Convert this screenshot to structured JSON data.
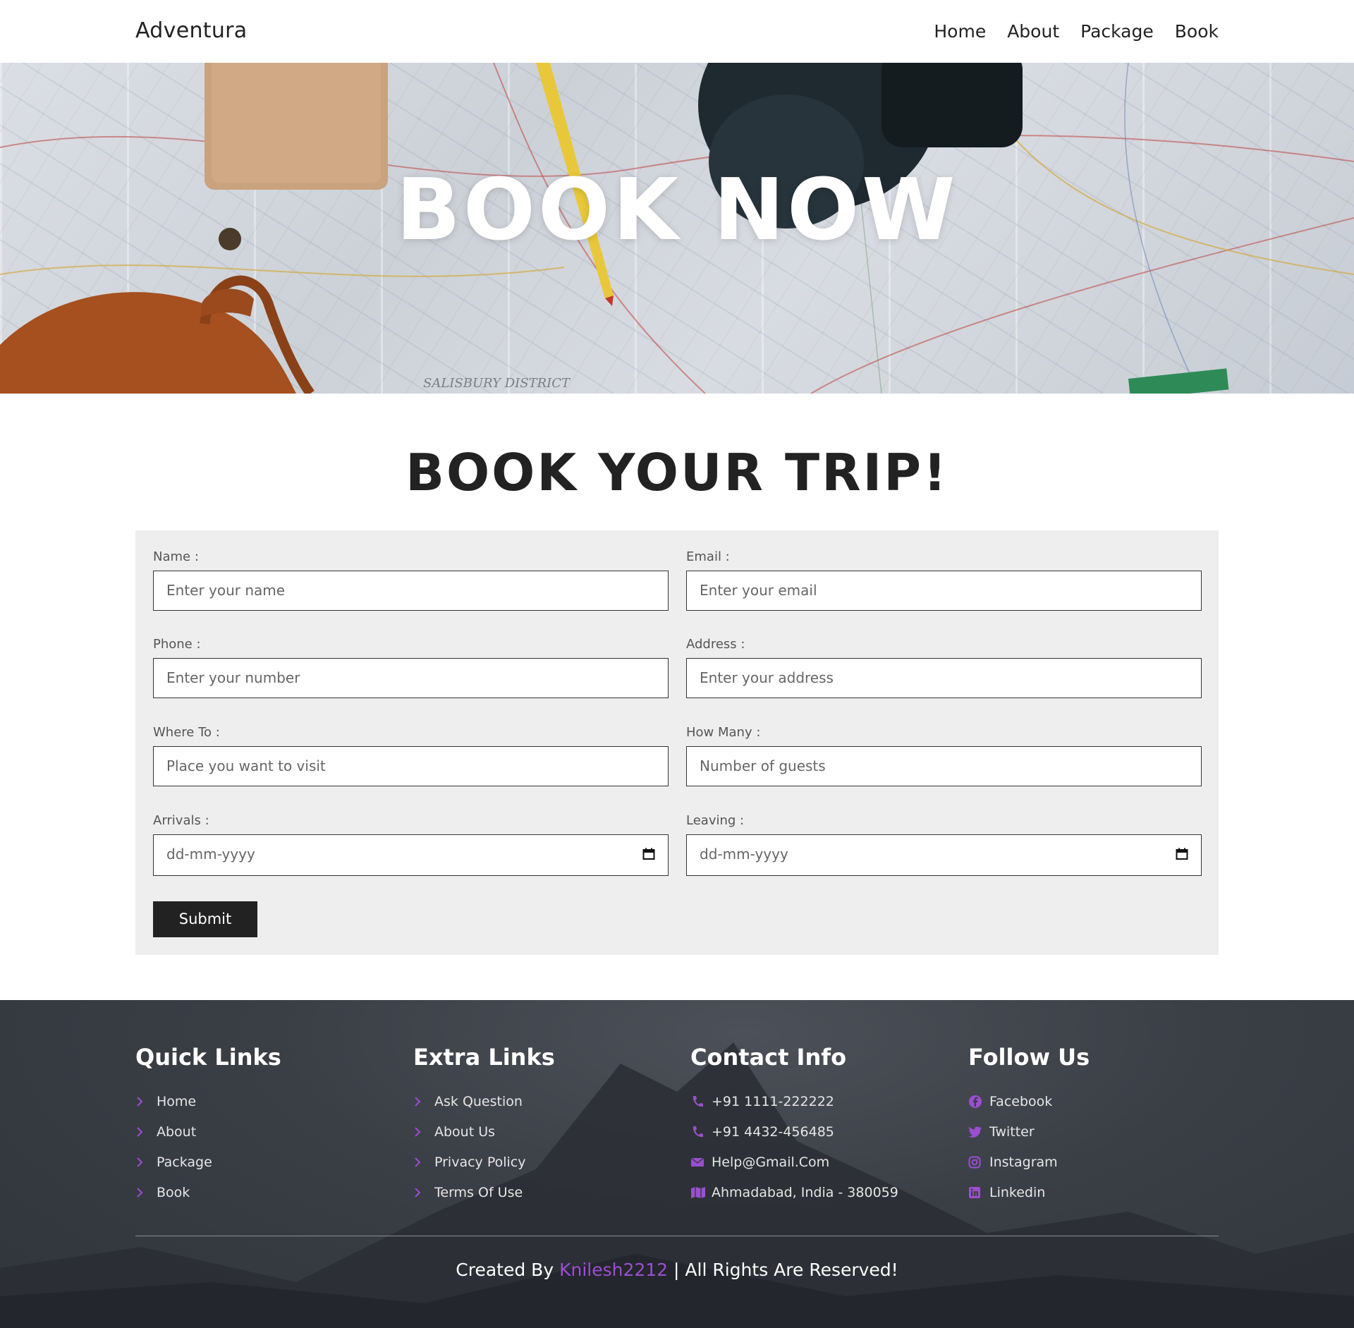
{
  "header": {
    "logo": "Adventura",
    "nav": [
      "Home",
      "About",
      "Package",
      "Book"
    ]
  },
  "hero": {
    "title": "BOOK NOW",
    "map_label": "SALISBURY DISTRICT"
  },
  "section": {
    "heading": "BOOK YOUR TRIP!"
  },
  "form": {
    "name": {
      "label": "Name :",
      "placeholder": "Enter your name"
    },
    "email": {
      "label": "Email :",
      "placeholder": "Enter your email"
    },
    "phone": {
      "label": "Phone :",
      "placeholder": "Enter your number"
    },
    "address": {
      "label": "Address :",
      "placeholder": "Enter your address"
    },
    "where": {
      "label": "Where To :",
      "placeholder": "Place you want to visit"
    },
    "guests": {
      "label": "How Many :",
      "placeholder": "Number of guests"
    },
    "arrivals": {
      "label": "Arrivals :",
      "placeholder": "dd-mm-yyyy"
    },
    "leaving": {
      "label": "Leaving :",
      "placeholder": "dd-mm-yyyy"
    },
    "submit": "Submit"
  },
  "footer": {
    "quick": {
      "title": "Quick Links",
      "items": [
        "Home",
        "About",
        "Package",
        "Book"
      ]
    },
    "extra": {
      "title": "Extra Links",
      "items": [
        "Ask Question",
        "About Us",
        "Privacy Policy",
        "Terms Of Use"
      ]
    },
    "contact": {
      "title": "Contact Info",
      "items": [
        "+91 1111-222222",
        "+91 4432-456485",
        "Help@Gmail.Com",
        "Ahmadabad, India - 380059"
      ]
    },
    "follow": {
      "title": "Follow Us",
      "items": [
        "Facebook",
        "Twitter",
        "Instagram",
        "Linkedin"
      ]
    },
    "credit": {
      "prefix": "Created By",
      "author": "Knilesh2212",
      "suffix": "| All Rights Are Reserved!"
    },
    "accent_color": "#9b4fd0"
  }
}
